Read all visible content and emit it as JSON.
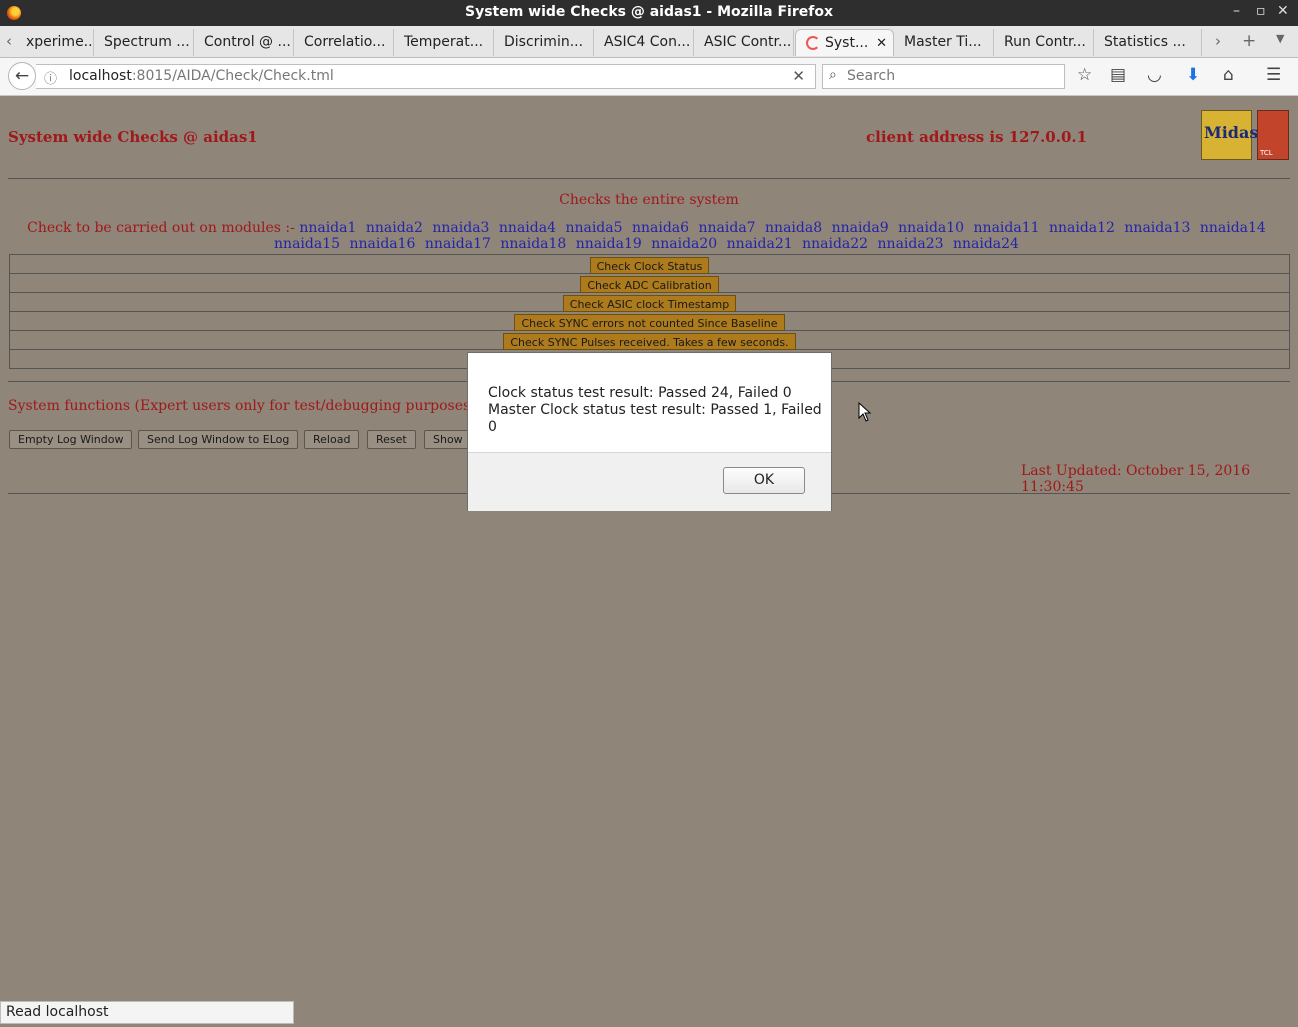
{
  "window": {
    "title": "System wide Checks @ aidas1 - Mozilla Firefox",
    "controls": [
      "–",
      "▫",
      "✕"
    ]
  },
  "tabs": [
    {
      "label": "xperime..."
    },
    {
      "label": "Spectrum ..."
    },
    {
      "label": "Control @ ..."
    },
    {
      "label": "Correlatio..."
    },
    {
      "label": "Temperat..."
    },
    {
      "label": "Discrimin..."
    },
    {
      "label": "ASIC4 Con..."
    },
    {
      "label": "ASIC Contr..."
    },
    {
      "label": "Syst..."
    },
    {
      "label": "Master Ti..."
    },
    {
      "label": "Run Contr..."
    },
    {
      "label": "Statistics ..."
    }
  ],
  "navbar": {
    "url_host": "localhost",
    "url_path": ":8015/AIDA/Check/Check.tml",
    "search_placeholder": "Search"
  },
  "page": {
    "title_left": "System wide Checks @ aidas1",
    "client_address": "client address is 127.0.0.1",
    "logo_text": "Midas",
    "tcl_logo_text": "TCL",
    "checks_title": "Checks the entire system",
    "modules_prefix": "Check to be carried out on modules :-",
    "modules": [
      "nnaida1",
      "nnaida2",
      "nnaida3",
      "nnaida4",
      "nnaida5",
      "nnaida6",
      "nnaida7",
      "nnaida8",
      "nnaida9",
      "nnaida10",
      "nnaida11",
      "nnaida12",
      "nnaida13",
      "nnaida14",
      "nnaida15",
      "nnaida16",
      "nnaida17",
      "nnaida18",
      "nnaida19",
      "nnaida20",
      "nnaida21",
      "nnaida22",
      "nnaida23",
      "nnaida24"
    ],
    "check_buttons": [
      "Check Clock Status",
      "Check ADC Calibration",
      "Check ASIC clock Timestamp",
      "Check SYNC errors not counted Since Baseline",
      "Check SYNC Pulses received. Takes a few seconds."
    ],
    "system_functions": "System functions (Expert users only for test/debugging purposes!!!)",
    "buttons": {
      "empty_log": "Empty Log Window",
      "send_log": "Send Log Window to ELog",
      "reload": "Reload",
      "reset": "Reset",
      "show": "Show"
    },
    "last_updated": "Last Updated: October 15, 2016 11:30:45"
  },
  "dialog": {
    "line1": "Clock status test result: Passed 24, Failed 0",
    "line2": "Master Clock status test result: Passed 1, Failed 0",
    "ok_label": "OK"
  },
  "statusbar": {
    "text": "Read localhost"
  }
}
